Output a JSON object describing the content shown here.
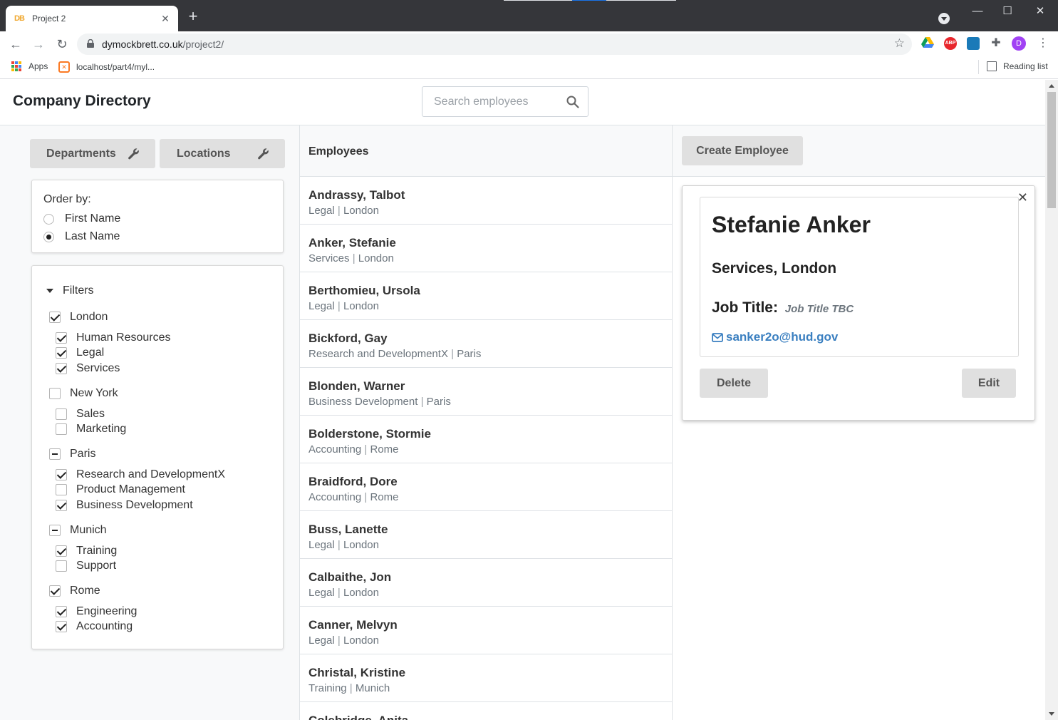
{
  "browser": {
    "tab_title": "Project 2",
    "tab_favicon_text": "DB",
    "url_host": "dymockbrett.co.uk",
    "url_path": "/project2/",
    "bookmarks": {
      "apps_label": "Apps",
      "local_label": "localhost/part4/myl...",
      "reading_list_label": "Reading list"
    },
    "extensions": [
      "google-drive-icon",
      "adblock-plus-icon",
      "reader-extension-icon",
      "puzzle-extensions-icon"
    ],
    "profile_initial": "D",
    "extension_abp_text": "ABP"
  },
  "app": {
    "title": "Company Directory",
    "search": {
      "placeholder": "Search employees"
    }
  },
  "left": {
    "departments_label": "Departments",
    "locations_label": "Locations",
    "order_title": "Order by:",
    "order_options": [
      {
        "label": "First Name",
        "selected": false
      },
      {
        "label": "Last Name",
        "selected": true
      }
    ],
    "filters_label": "Filters",
    "locations": [
      {
        "name": "London",
        "state": "checked",
        "departments": [
          {
            "name": "Human Resources",
            "checked": true
          },
          {
            "name": "Legal",
            "checked": true
          },
          {
            "name": "Services",
            "checked": true
          }
        ]
      },
      {
        "name": "New York",
        "state": "unchecked",
        "departments": [
          {
            "name": "Sales",
            "checked": false
          },
          {
            "name": "Marketing",
            "checked": false
          }
        ]
      },
      {
        "name": "Paris",
        "state": "partial",
        "departments": [
          {
            "name": "Research and DevelopmentX",
            "checked": true
          },
          {
            "name": "Product Management",
            "checked": false
          },
          {
            "name": "Business Development",
            "checked": true
          }
        ]
      },
      {
        "name": "Munich",
        "state": "partial",
        "departments": [
          {
            "name": "Training",
            "checked": true
          },
          {
            "name": "Support",
            "checked": false
          }
        ]
      },
      {
        "name": "Rome",
        "state": "checked",
        "departments": [
          {
            "name": "Engineering",
            "checked": true
          },
          {
            "name": "Accounting",
            "checked": true
          }
        ]
      }
    ]
  },
  "employees": {
    "title": "Employees",
    "items": [
      {
        "name": "Andrassy, Talbot",
        "department": "Legal",
        "location": "London"
      },
      {
        "name": "Anker, Stefanie",
        "department": "Services",
        "location": "London"
      },
      {
        "name": "Berthomieu, Ursola",
        "department": "Legal",
        "location": "London"
      },
      {
        "name": "Bickford, Gay",
        "department": "Research and DevelopmentX",
        "location": "Paris"
      },
      {
        "name": "Blonden, Warner",
        "department": "Business Development",
        "location": "Paris"
      },
      {
        "name": "Bolderstone, Stormie",
        "department": "Accounting",
        "location": "Rome"
      },
      {
        "name": "Braidford, Dore",
        "department": "Accounting",
        "location": "Rome"
      },
      {
        "name": "Buss, Lanette",
        "department": "Legal",
        "location": "London"
      },
      {
        "name": "Calbaithe, Jon",
        "department": "Legal",
        "location": "London"
      },
      {
        "name": "Canner, Melvyn",
        "department": "Legal",
        "location": "London"
      },
      {
        "name": "Christal, Kristine",
        "department": "Training",
        "location": "Munich"
      },
      {
        "name": "Colebridge, Anita",
        "department": "",
        "location": ""
      }
    ]
  },
  "detail": {
    "create_label": "Create Employee",
    "name": "Stefanie Anker",
    "dept_location": "Services, London",
    "job_title_label": "Job Title:",
    "job_title_value": "Job Title TBC",
    "email": "sanker2o@hud.gov",
    "delete_label": "Delete",
    "edit_label": "Edit"
  },
  "colors": {
    "link": "#3a7fc0",
    "button_gray": "#e0e0e0",
    "chrome_dark": "#35363a"
  }
}
